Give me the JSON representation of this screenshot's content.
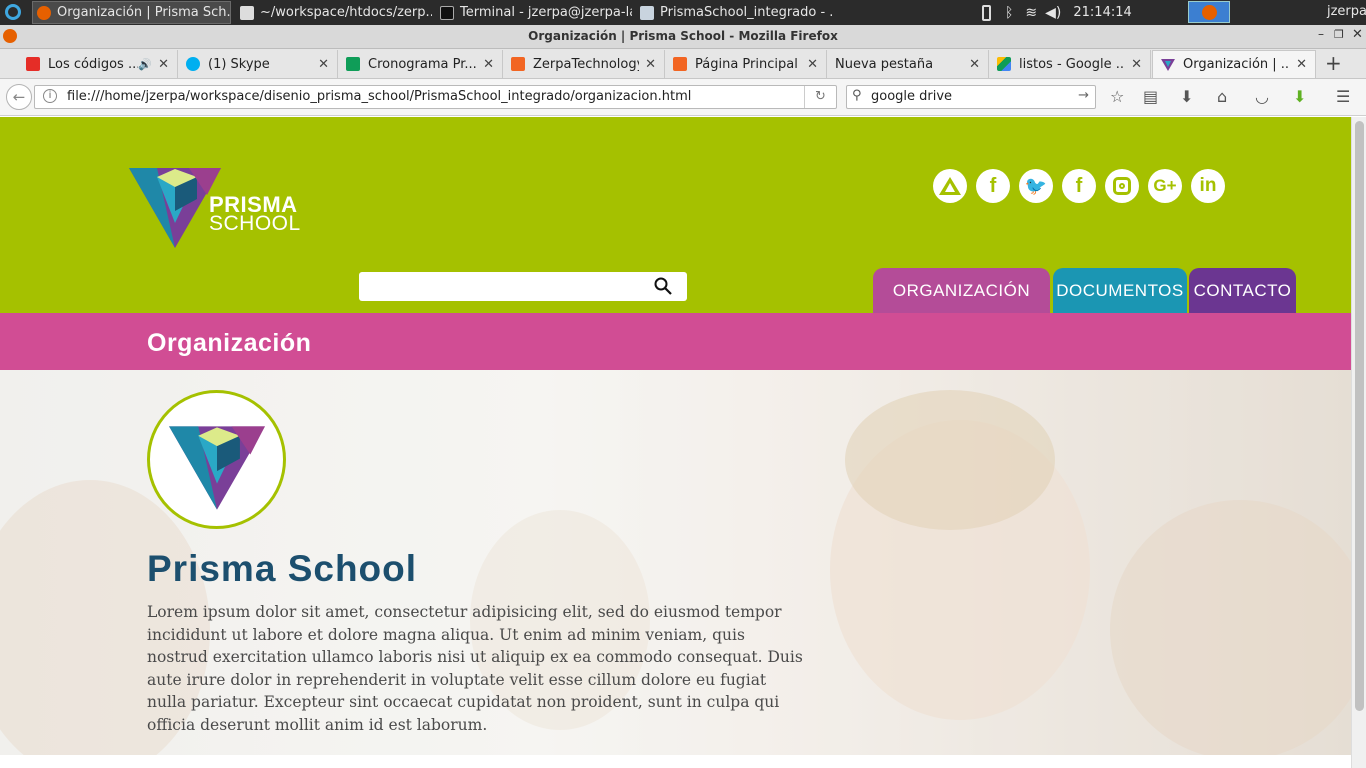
{
  "taskbar": {
    "tasks": [
      {
        "label": "Organización | Prisma Sch...",
        "active": true
      },
      {
        "label": "~/workspace/htdocs/zerp...",
        "active": false
      },
      {
        "label": "Terminal - jzerpa@jzerpa-la...",
        "active": false
      },
      {
        "label": "PrismaSchool_integrado - ...",
        "active": false
      }
    ],
    "clock": "21:14:14",
    "user": "jzerpa"
  },
  "window": {
    "title": "Organización | Prisma School - Mozilla Firefox"
  },
  "tabs": [
    {
      "label": "Los códigos ...",
      "icon": "youtube-icon",
      "color": "#e52d27"
    },
    {
      "label": "(1) Skype",
      "icon": "skype-icon",
      "color": "#00aff0"
    },
    {
      "label": "Cronograma Pr...",
      "icon": "sheets-icon",
      "color": "#0f9d58"
    },
    {
      "label": "ZerpaTechnology",
      "icon": "site-icon",
      "color": "#f26522"
    },
    {
      "label": "Página Principal",
      "icon": "site-icon",
      "color": "#f26522"
    },
    {
      "label": "Nueva pestaña",
      "icon": "",
      "color": ""
    },
    {
      "label": "listos - Google ...",
      "icon": "drive-icon",
      "color": "#fbbc05"
    },
    {
      "label": "Organización | ...",
      "icon": "prisma-icon",
      "color": "#7a3f98"
    }
  ],
  "nav": {
    "url": "file:///home/jzerpa/workspace/disenio_prisma_school/PrismaSchool_integrado/organizacion.html",
    "search": "google drive"
  },
  "site": {
    "logo_line1": "PRISMA",
    "logo_line2": "SCHOOL",
    "social": [
      "prisma",
      "f",
      "t",
      "f",
      "ig",
      "G+",
      "in"
    ],
    "menu": [
      "ORGANIZACIÓN",
      "DOCUMENTOS",
      "CONTACTO"
    ],
    "section_title": "Organización",
    "school_name": "Prisma School",
    "paragraph": "Lorem ipsum dolor sit amet, consectetur adipisicing elit, sed do eiusmod tempor incididunt ut labore et dolore magna aliqua. Ut enim ad minim veniam, quis nostrud exercitation ullamco laboris nisi ut aliquip ex ea commodo consequat. Duis aute irure dolor in reprehenderit in voluptate velit esse cillum dolore eu fugiat nulla pariatur. Excepteur sint occaecat cupidatat non proident, sunt in culpa qui officia deserunt mollit anim id est laborum."
  },
  "colors": {
    "green": "#a5c100",
    "pink": "#d14d94",
    "menu_org": "#b44c98",
    "menu_doc": "#1b96b3",
    "menu_contact": "#6b3691",
    "title_blue": "#1c4f6e"
  }
}
